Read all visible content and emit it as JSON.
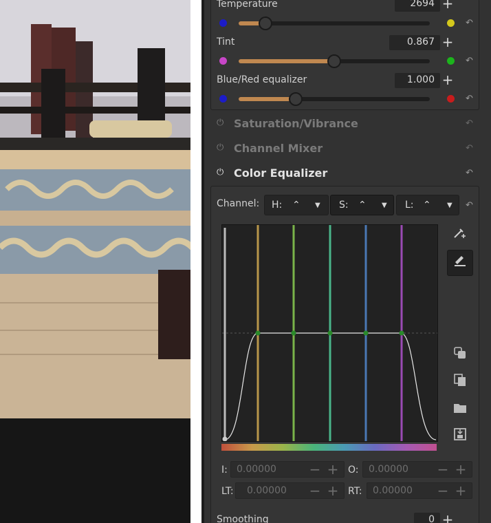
{
  "white_balance": {
    "temperature": {
      "label": "Temperature",
      "value": "2694",
      "fill": 0.14,
      "color_low": "#1c1cc8",
      "color_high": "#d4c81c"
    },
    "tint": {
      "label": "Tint",
      "value": "0.867",
      "fill": 0.5,
      "color_low": "#c846c8",
      "color_high": "#1cb41c"
    },
    "blue_red": {
      "label": "Blue/Red equalizer",
      "value": "1.000",
      "fill": 0.3,
      "color_low": "#1c1cc8",
      "color_high": "#c81c1c"
    }
  },
  "sections": {
    "saturation": "Saturation/Vibrance",
    "channel_mixer": "Channel Mixer",
    "color_equalizer": "Color Equalizer"
  },
  "equalizer": {
    "channel_label": "Channel:",
    "channels": [
      {
        "label": "H:",
        "selected": false
      },
      {
        "label": "S:",
        "selected": true
      },
      {
        "label": "L:",
        "selected": false
      }
    ],
    "curve_lines": [
      "#b8964a",
      "#7ab44a",
      "#4ab48a",
      "#4a78b4",
      "#9a4ab4"
    ],
    "fields": {
      "i_label": "I:",
      "i_value": "0.00000",
      "o_label": "O:",
      "o_value": "0.00000",
      "lt_label": "LT:",
      "lt_value": "0.00000",
      "rt_label": "RT:",
      "rt_value": "0.00000"
    }
  },
  "smoothing": {
    "label": "Smoothing",
    "value": "0"
  },
  "icons": {
    "minus": "−",
    "plus": "+",
    "reset": "↶",
    "power": "⏻",
    "dropdown": "▼",
    "curve": "⌃"
  }
}
